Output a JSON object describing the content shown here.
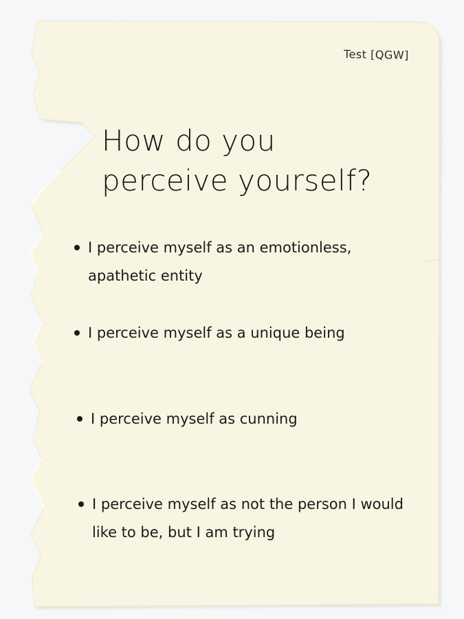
{
  "page": {
    "tag": "Test [QGW]",
    "question": "How do you perceive yourself?",
    "answers": [
      "I perceive myself as an emotionless, apathetic entity",
      "I perceive myself as a unique being",
      "I perceive myself as cunning",
      "I perceive myself as not the person I would like to be, but I am trying"
    ]
  },
  "colors": {
    "paper": "#f8f5e3",
    "ink": "#1a1a1a",
    "background": "#f6f7f8"
  },
  "icons": {
    "bullet": "filled-dot"
  }
}
